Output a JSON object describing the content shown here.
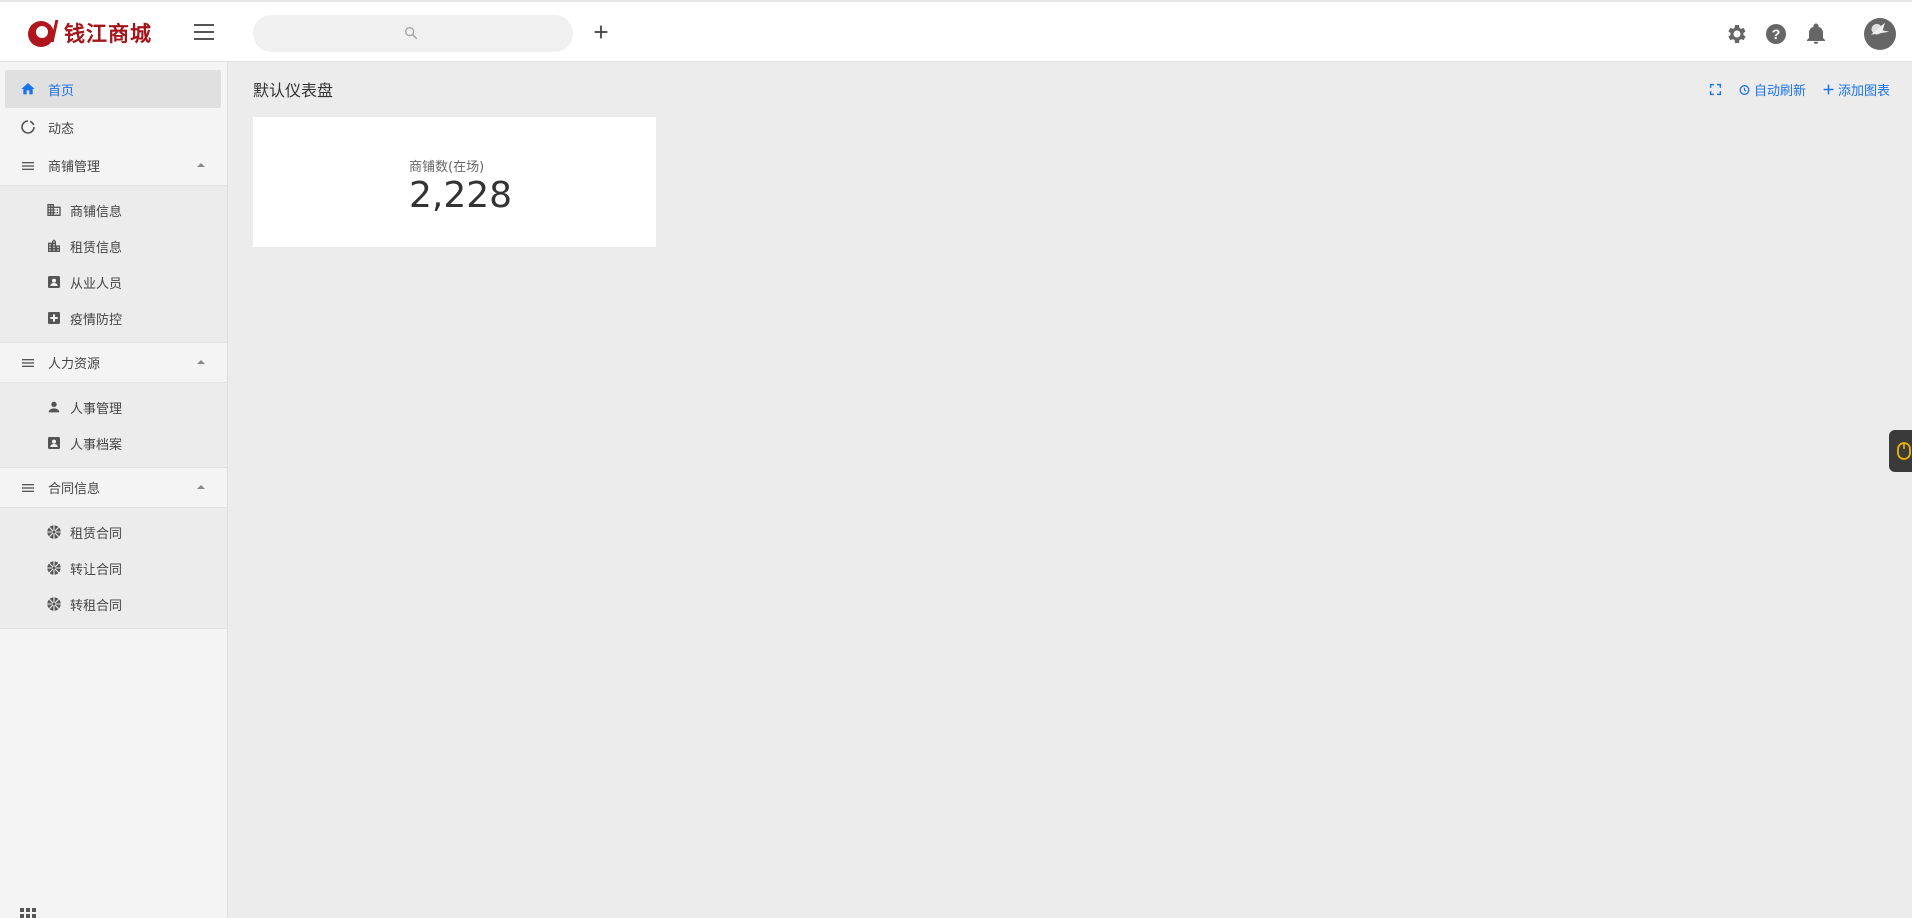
{
  "header": {
    "logo_text": "钱江商城",
    "search_placeholder": "",
    "icons": [
      "menu-icon",
      "search-icon",
      "plus-icon",
      "gear-icon",
      "help-icon",
      "bell-icon"
    ]
  },
  "sidebar": {
    "home_label": "首页",
    "activity_label": "动态",
    "groups": [
      {
        "label": "商铺管理",
        "items": [
          {
            "label": "商铺信息",
            "icon": "building-icon"
          },
          {
            "label": "租赁信息",
            "icon": "city-icon"
          },
          {
            "label": "从业人员",
            "icon": "contact-card-icon"
          },
          {
            "label": "疫情防控",
            "icon": "medical-plus-icon"
          }
        ]
      },
      {
        "label": "人力资源",
        "items": [
          {
            "label": "人事管理",
            "icon": "person-icon"
          },
          {
            "label": "人事档案",
            "icon": "contact-card-icon"
          }
        ]
      },
      {
        "label": "合同信息",
        "items": [
          {
            "label": "租赁合同",
            "icon": "aperture-icon"
          },
          {
            "label": "转让合同",
            "icon": "aperture-icon"
          },
          {
            "label": "转租合同",
            "icon": "aperture-icon"
          }
        ]
      }
    ]
  },
  "main": {
    "title": "默认仪表盘",
    "actions": {
      "auto_refresh": "自动刷新",
      "add_chart": "添加图表"
    },
    "card": {
      "label": "商铺数(在场)",
      "value": "2,228"
    }
  },
  "colors": {
    "brand": "#a3151a",
    "accent": "#1a73e8",
    "background": "#ececec"
  }
}
